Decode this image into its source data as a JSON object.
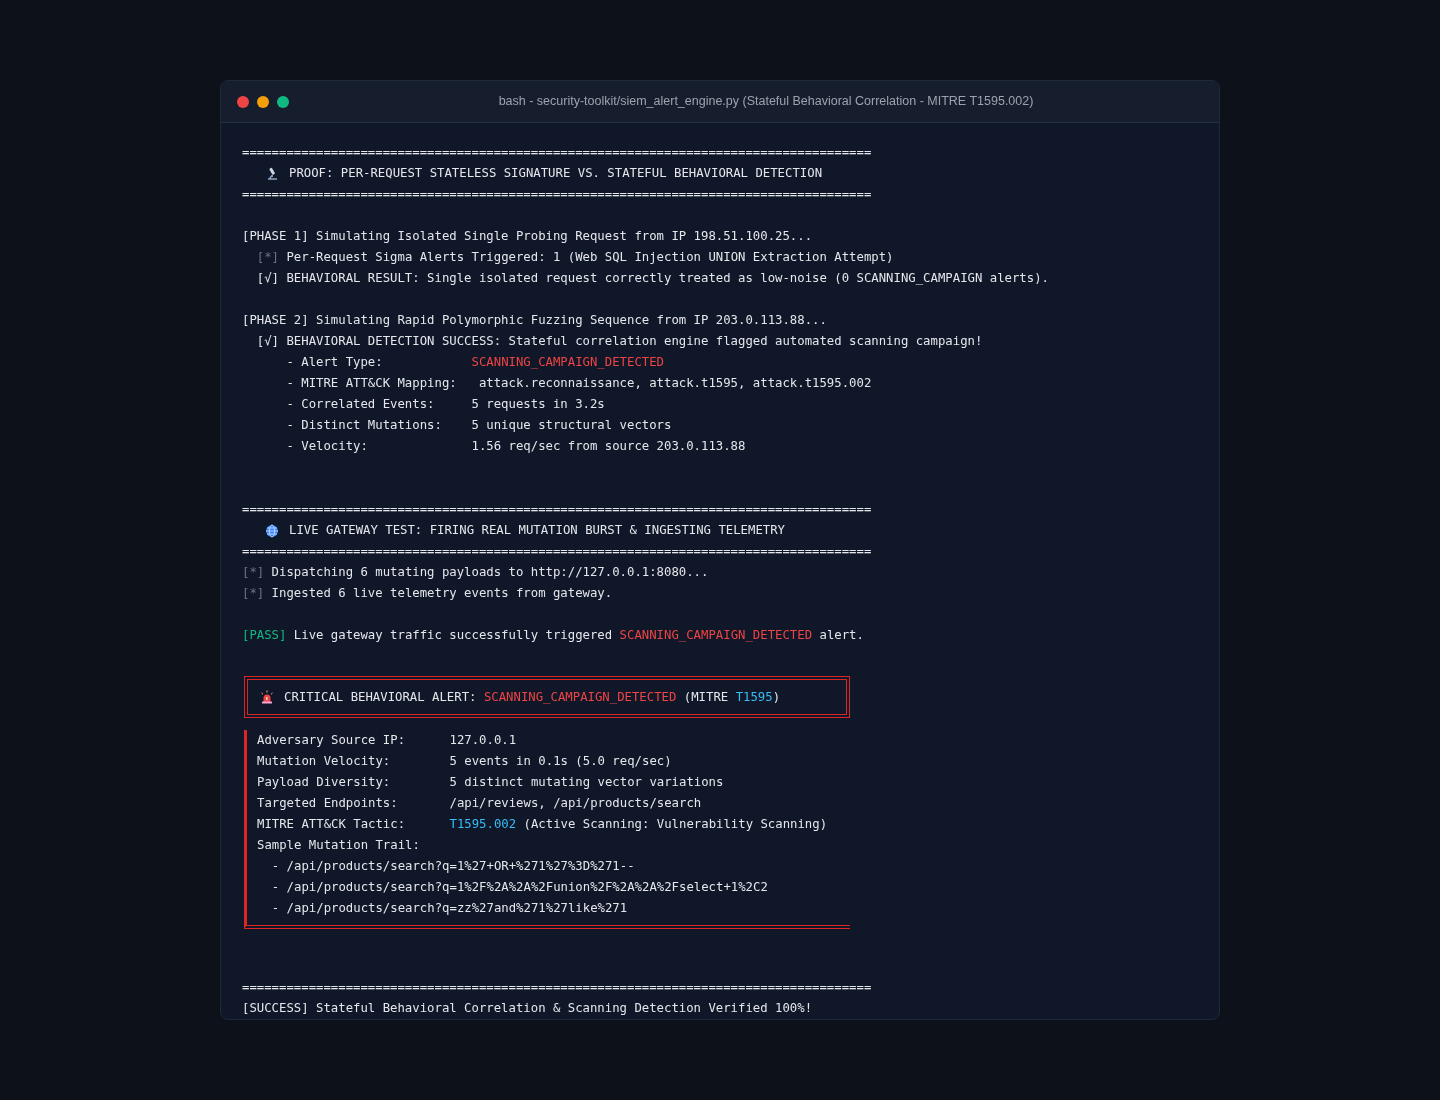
{
  "window": {
    "title": "bash - security-toolkit/siem_alert_engine.py (Stateful Behavioral Correlation - MITRE T1595.002)"
  },
  "lines": [
    {
      "kind": "text",
      "segments": [
        {
          "kind": "plain",
          "text": "====================================================================================="
        }
      ]
    },
    {
      "kind": "heading",
      "text": "PROOF: PER-REQUEST STATELESS SIGNATURE VS. STATEFUL BEHAVIORAL DETECTION"
    },
    {
      "kind": "text",
      "segments": [
        {
          "kind": "plain",
          "text": "====================================================================================="
        }
      ]
    },
    {
      "kind": "blank"
    },
    {
      "kind": "text",
      "segments": [
        {
          "kind": "plain",
          "text": "[PHASE 1] Simulating Isolated Single Probing Request from IP 198.51.100.25..."
        }
      ]
    },
    {
      "kind": "text",
      "segments": [
        {
          "kind": "dim",
          "text": "  [*]"
        },
        {
          "kind": "plain",
          "text": " Per-Request Sigma Alerts Triggered: 1 (Web SQL Injection UNION Extraction Attempt)"
        }
      ]
    },
    {
      "kind": "text",
      "segments": [
        {
          "kind": "plain",
          "text": "  [√] BEHAVIORAL RESULT: Single isolated request correctly treated as low-noise (0 SCANNING_CAMPAIGN alerts)."
        }
      ]
    },
    {
      "kind": "blank"
    },
    {
      "kind": "text",
      "segments": [
        {
          "kind": "plain",
          "text": "[PHASE 2] Simulating Rapid Polymorphic Fuzzing Sequence from IP 203.0.113.88..."
        }
      ]
    },
    {
      "kind": "text",
      "segments": [
        {
          "kind": "plain",
          "text": "  [√] BEHAVIORAL DETECTION SUCCESS: Stateful correlation engine flagged automated scanning campaign!"
        }
      ]
    },
    {
      "kind": "text",
      "segments": [
        {
          "kind": "plain",
          "text": "      - Alert Type:            "
        },
        {
          "kind": "alert",
          "text": "SCANNING_CAMPAIGN_DETECTED"
        }
      ]
    },
    {
      "kind": "text",
      "segments": [
        {
          "kind": "plain",
          "text": "      - MITRE ATT&CK Mapping:   attack.reconnaissance, attack.t1595, attack.t1595.002"
        }
      ]
    },
    {
      "kind": "text",
      "segments": [
        {
          "kind": "plain",
          "text": "      - Correlated Events:     5 requests in 3.2s"
        }
      ]
    },
    {
      "kind": "text",
      "segments": [
        {
          "kind": "plain",
          "text": "      - Distinct Mutations:    5 unique structural vectors"
        }
      ]
    },
    {
      "kind": "text",
      "segments": [
        {
          "kind": "plain",
          "text": "      - Velocity:              1.56 req/sec from source 203.0.113.88"
        }
      ]
    },
    {
      "kind": "blank"
    },
    {
      "kind": "blank"
    },
    {
      "kind": "text",
      "segments": [
        {
          "kind": "plain",
          "text": "====================================================================================="
        }
      ]
    },
    {
      "kind": "heading",
      "text": "LIVE GATEWAY TEST: FIRING REAL MUTATION BURST & INGESTING TELEMETRY"
    },
    {
      "kind": "text",
      "segments": [
        {
          "kind": "plain",
          "text": "====================================================================================="
        }
      ]
    },
    {
      "kind": "text",
      "segments": [
        {
          "kind": "dim",
          "text": "[*]"
        },
        {
          "kind": "plain",
          "text": " Dispatching 6 mutating payloads to http://127.0.0.1:8080..."
        }
      ]
    },
    {
      "kind": "text",
      "segments": [
        {
          "kind": "dim",
          "text": "[*]"
        },
        {
          "kind": "plain",
          "text": " Ingested 6 live telemetry events from gateway."
        }
      ]
    },
    {
      "kind": "blank"
    },
    {
      "kind": "text",
      "segments": [
        {
          "kind": "pass",
          "text": "[PASS]"
        },
        {
          "kind": "plain",
          "text": " Live gateway traffic successfully triggered "
        },
        {
          "kind": "alert",
          "text": "SCANNING_CAMPAIGN_DETECTED"
        },
        {
          "kind": "plain",
          "text": " alert."
        }
      ]
    },
    {
      "kind": "blank"
    },
    {
      "kind": "alert_box",
      "title": [
        {
          "kind": "plain",
          "text": "CRITICAL BEHAVIORAL ALERT: "
        },
        {
          "kind": "alert",
          "text": "SCANNING_CAMPAIGN_DETECTED"
        },
        {
          "kind": "plain",
          "text": " (MITRE "
        },
        {
          "kind": "tech",
          "text": "T1595"
        },
        {
          "kind": "plain",
          "text": ")"
        }
      ],
      "rows": [
        [
          {
            "kind": "plain",
            "text": "Adversary Source IP:      127.0.0.1"
          }
        ],
        [
          {
            "kind": "plain",
            "text": "Mutation Velocity:        5 events in 0.1s (5.0 req/sec)"
          }
        ],
        [
          {
            "kind": "plain",
            "text": "Payload Diversity:        5 distinct mutating vector variations"
          }
        ],
        [
          {
            "kind": "plain",
            "text": "Targeted Endpoints:       /api/reviews, /api/products/search"
          }
        ],
        [
          {
            "kind": "plain",
            "text": "MITRE ATT&CK Tactic:      "
          },
          {
            "kind": "tech",
            "text": "T1595.002"
          },
          {
            "kind": "plain",
            "text": " (Active Scanning: Vulnerability Scanning)"
          }
        ],
        [
          {
            "kind": "plain",
            "text": "Sample Mutation Trail:"
          }
        ],
        [
          {
            "kind": "plain",
            "text": "  - /api/products/search?q=1%27+OR+%271%27%3D%271--"
          }
        ],
        [
          {
            "kind": "plain",
            "text": "  - /api/products/search?q=1%2F%2A%2A%2Funion%2F%2A%2A%2Fselect+1%2C2"
          }
        ],
        [
          {
            "kind": "plain",
            "text": "  - /api/products/search?q=zz%27and%271%27like%271"
          }
        ]
      ]
    },
    {
      "kind": "blank"
    },
    {
      "kind": "blank"
    },
    {
      "kind": "text",
      "segments": [
        {
          "kind": "plain",
          "text": "====================================================================================="
        }
      ]
    },
    {
      "kind": "text",
      "segments": [
        {
          "kind": "plain",
          "text": "[SUCCESS] Stateful Behavioral Correlation & Scanning Detection Verified 100%!"
        }
      ]
    }
  ]
}
